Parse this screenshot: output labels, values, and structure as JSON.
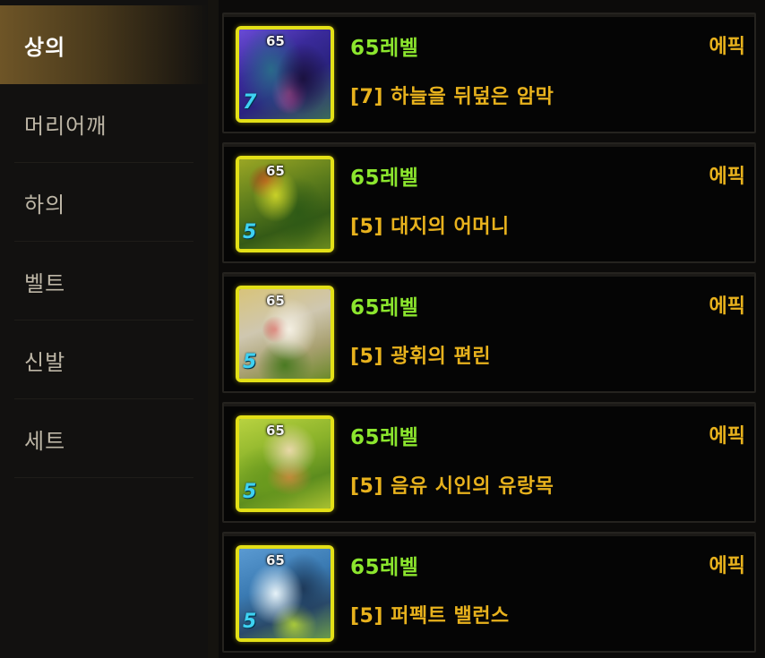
{
  "sidebar": {
    "items": [
      {
        "label": "상의",
        "active": true
      },
      {
        "label": "머리어깨",
        "active": false
      },
      {
        "label": "하의",
        "active": false
      },
      {
        "label": "벨트",
        "active": false
      },
      {
        "label": "신발",
        "active": false
      },
      {
        "label": "세트",
        "active": false
      }
    ]
  },
  "items": [
    {
      "level_text": "65레벨",
      "grade": "에픽",
      "name": "[7] 하늘을 뒤덮은 암막",
      "icon_level": "65",
      "upgrade_badge": "7",
      "icon_theme": "purple"
    },
    {
      "level_text": "65레벨",
      "grade": "에픽",
      "name": "[5] 대지의 어머니",
      "icon_level": "65",
      "upgrade_badge": "5",
      "icon_theme": "green"
    },
    {
      "level_text": "65레벨",
      "grade": "에픽",
      "name": "[5] 광휘의 편린",
      "icon_level": "65",
      "upgrade_badge": "5",
      "icon_theme": "white-gold"
    },
    {
      "level_text": "65레벨",
      "grade": "에픽",
      "name": "[5] 음유 시인의 유랑목",
      "icon_level": "65",
      "upgrade_badge": "5",
      "icon_theme": "yellow-green"
    },
    {
      "level_text": "65레벨",
      "grade": "에픽",
      "name": "[5] 퍼펙트 밸런스",
      "icon_level": "65",
      "upgrade_badge": "5",
      "icon_theme": "blue"
    }
  ],
  "colors": {
    "level_green": "#8ce62e",
    "epic_gold": "#e8b21d",
    "icon_frame": "#e3e017"
  }
}
